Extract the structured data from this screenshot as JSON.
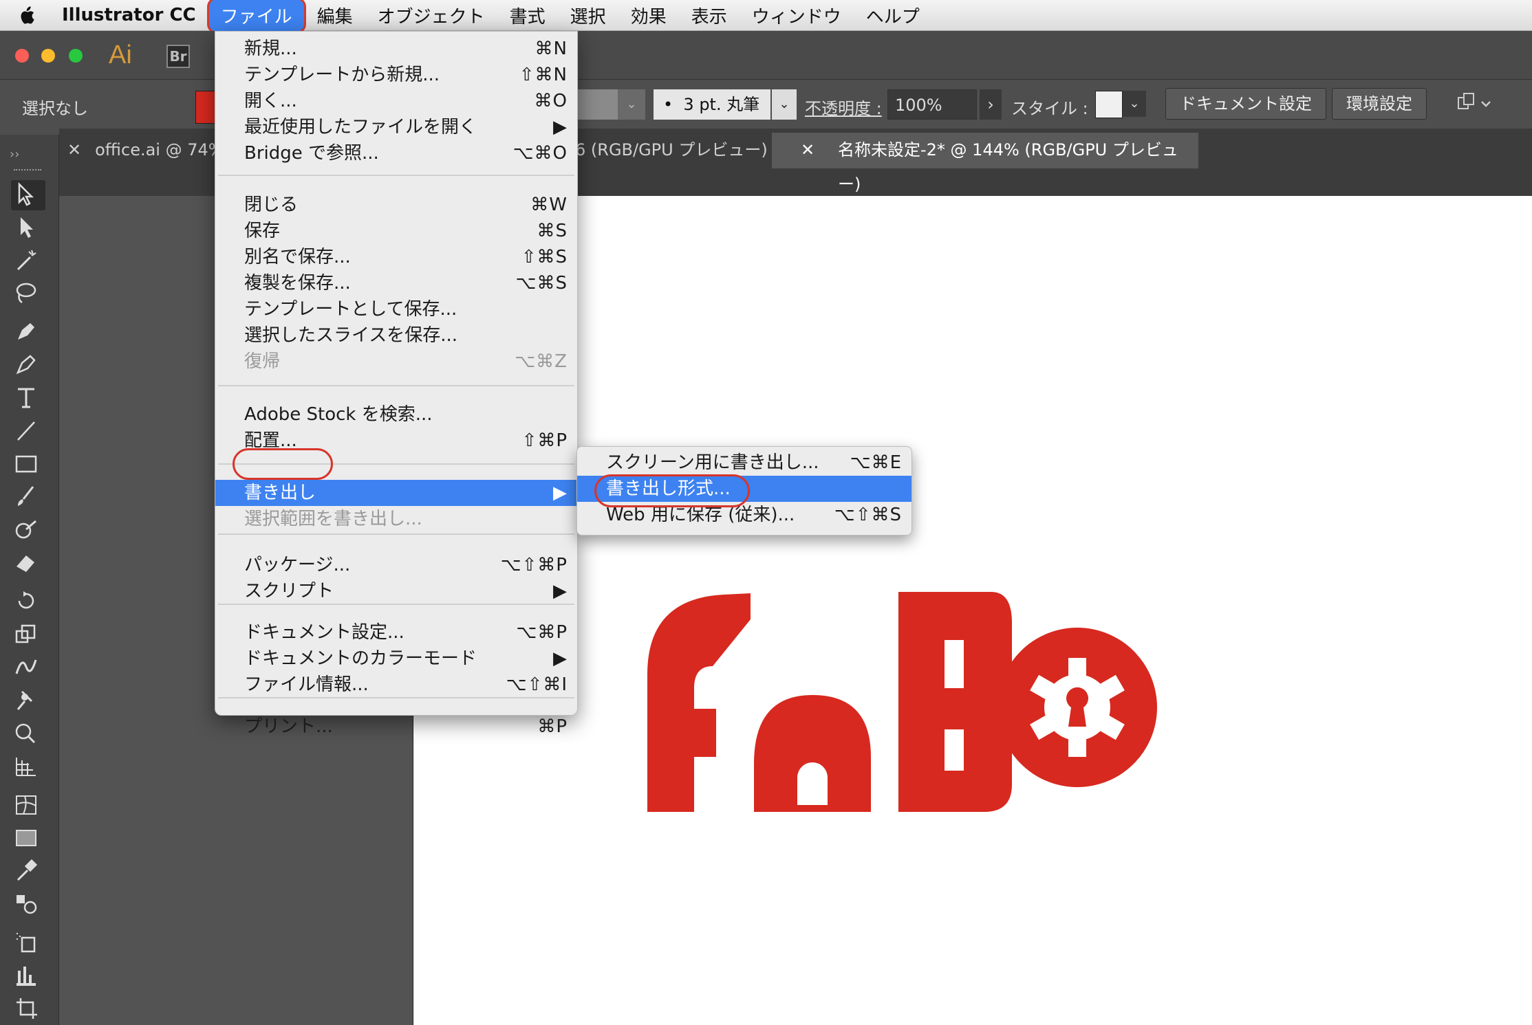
{
  "menubar": {
    "app_name": "Illustrator CC",
    "items": [
      "ファイル",
      "編集",
      "オブジェクト",
      "書式",
      "選択",
      "効果",
      "表示",
      "ウィンドウ",
      "ヘルプ"
    ],
    "active_item": "ファイル"
  },
  "titlebar": {
    "ai_logo": "Ai",
    "bridge_badge": "Br"
  },
  "controlbar": {
    "selection": "選択なし",
    "brush": "3 pt. 丸筆",
    "brush_bullet": "•",
    "opacity_label": "不透明度 :",
    "opacity_value": "100%",
    "style_label": "スタイル :",
    "document_settings_button": "ドキュメント設定",
    "preferences_button": "環境設定"
  },
  "tabs": [
    {
      "label": "office.ai @ 74% ("
    },
    {
      "label": "6 (RGB/GPU プレビュー)"
    },
    {
      "label": "名称未設定-2* @ 144% (RGB/GPU プレビュー)",
      "active": true
    }
  ],
  "file_menu": {
    "items": [
      {
        "label": "新規...",
        "shortcut": "⌘N"
      },
      {
        "label": "テンプレートから新規...",
        "shortcut": "⇧⌘N"
      },
      {
        "label": "開く...",
        "shortcut": "⌘O"
      },
      {
        "label": "最近使用したファイルを開く",
        "shortcut": "▶"
      },
      {
        "label": "Bridge で参照...",
        "shortcut": "⌥⌘O"
      },
      {
        "label": "閉じる",
        "shortcut": "⌘W"
      },
      {
        "label": "保存",
        "shortcut": "⌘S"
      },
      {
        "label": "別名で保存...",
        "shortcut": "⇧⌘S"
      },
      {
        "label": "複製を保存...",
        "shortcut": "⌥⌘S"
      },
      {
        "label": "テンプレートとして保存...",
        "shortcut": ""
      },
      {
        "label": "選択したスライスを保存...",
        "shortcut": ""
      },
      {
        "label": "復帰",
        "shortcut": "⌥⌘Z",
        "disabled": true
      },
      {
        "label": "Adobe Stock を検索...",
        "shortcut": ""
      },
      {
        "label": "配置...",
        "shortcut": "⇧⌘P"
      },
      {
        "label": "書き出し",
        "shortcut": "▶",
        "highlighted": true
      },
      {
        "label": "選択範囲を書き出し...",
        "shortcut": "",
        "disabled": true
      },
      {
        "label": "パッケージ...",
        "shortcut": "⌥⇧⌘P"
      },
      {
        "label": "スクリプト",
        "shortcut": "▶"
      },
      {
        "label": "ドキュメント設定...",
        "shortcut": "⌥⌘P"
      },
      {
        "label": "ドキュメントのカラーモード",
        "shortcut": "▶"
      },
      {
        "label": "ファイル情報...",
        "shortcut": "⌥⇧⌘I"
      },
      {
        "label": "プリント...",
        "shortcut": "⌘P"
      }
    ]
  },
  "export_submenu": {
    "items": [
      {
        "label": "スクリーン用に書き出し...",
        "shortcut": "⌥⌘E"
      },
      {
        "label": "書き出し形式...",
        "shortcut": "",
        "highlighted": true
      },
      {
        "label": "Web 用に保存 (従来)...",
        "shortcut": "⌥⇧⌘S"
      }
    ]
  },
  "artwork": {
    "logo_text": "FaBo",
    "color": "#d7291f"
  },
  "colors": {
    "menu_highlight": "#3d82f0",
    "annotation_ring": "#d8352a",
    "fill_swatch": "#d7291f"
  }
}
